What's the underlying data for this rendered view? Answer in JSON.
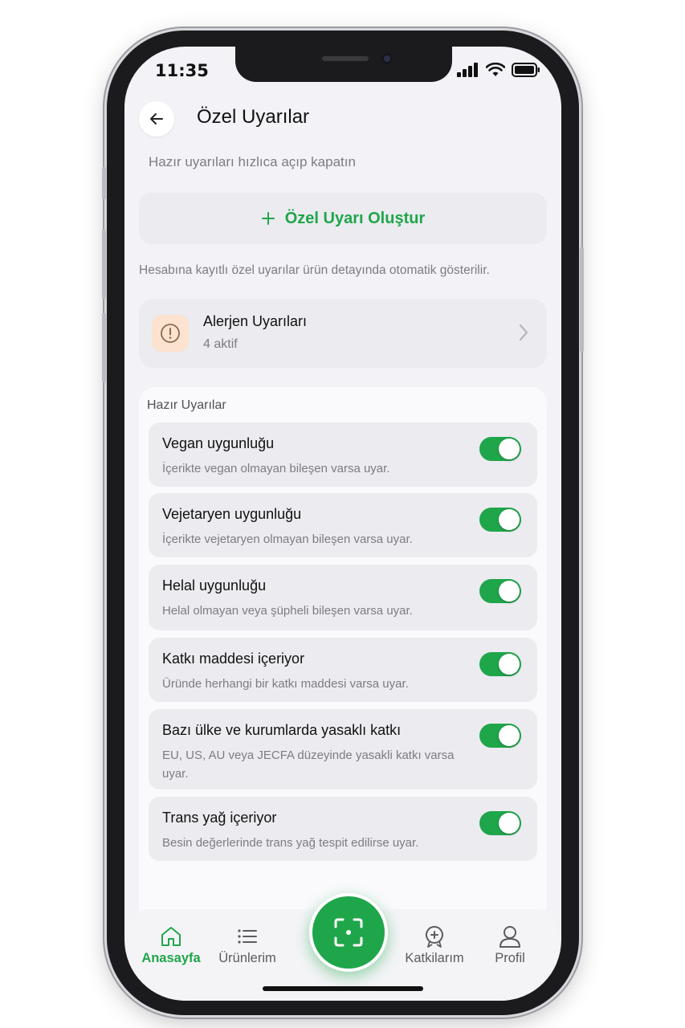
{
  "status": {
    "time": "11:35"
  },
  "header": {
    "title": "Özel Uyarılar",
    "subtitle": "Hazır uyarıları hızlıca açıp kapatın"
  },
  "create_button": {
    "icon": "plus-icon",
    "label": "Özel Uyarı Oluştur"
  },
  "info_text": "Hesabına kayıtlı özel uyarılar ürün detayında otomatik gösterilir.",
  "allergen_card": {
    "icon": "alert-circle-icon",
    "title": "Alerjen Uyarıları",
    "count": "4 aktif"
  },
  "ready_warnings": {
    "section_title": "Hazır Uyarılar",
    "items": [
      {
        "title": "Vegan uygunluğu",
        "desc": "İçerikte vegan olmayan bileşen varsa uyar.",
        "enabled": true
      },
      {
        "title": "Vejetaryen uygunluğu",
        "desc": "İçerikte vejetaryen olmayan bileşen varsa uyar.",
        "enabled": true
      },
      {
        "title": "Helal uygunluğu",
        "desc": "Helal olmayan veya şüpheli bileşen varsa uyar.",
        "enabled": true
      },
      {
        "title": "Katkı maddesi içeriyor",
        "desc": "Üründe herhangi bir katkı maddesi varsa uyar.",
        "enabled": true
      },
      {
        "title": "Bazı ülke ve kurumlarda yasaklı katkı",
        "desc": "EU, US, AU veya JECFA düzeyinde yasakli katkı varsa uyar.",
        "enabled": true
      },
      {
        "title": "Trans yağ içeriyor",
        "desc": "Besin değerlerinde trans yağ tespit edilirse uyar.",
        "enabled": true
      }
    ]
  },
  "tabbar": {
    "home": "Anasayfa",
    "products": "Ürünlerim",
    "contributions": "Katkilarım",
    "profile": "Profil",
    "scan_icon": "scan-icon"
  },
  "colors": {
    "accent": "#1fa64a",
    "background": "#f2f2f7",
    "card": "#ebebf0"
  }
}
